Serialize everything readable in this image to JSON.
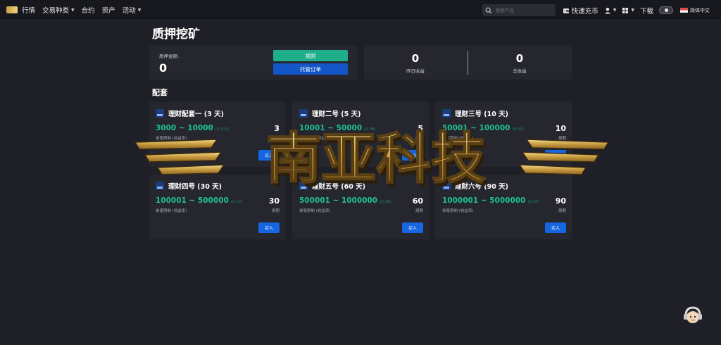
{
  "nav": {
    "items": [
      {
        "label": "行情",
        "caret": false
      },
      {
        "label": "交易种类",
        "caret": true
      },
      {
        "label": "合约",
        "caret": false
      },
      {
        "label": "资产",
        "caret": false
      },
      {
        "label": "活动",
        "caret": true
      }
    ],
    "search_placeholder": "搜索产品",
    "quick_recharge": "快速充币",
    "download": "下载",
    "language": "简体中文"
  },
  "page": {
    "title": "质押挖矿",
    "pledge_label": "质押金额:",
    "pledge_value": "0",
    "rule_button": "规则",
    "orders_button": "托管订单",
    "yesterday_value": "0",
    "yesterday_label": "昨日收益",
    "total_value": "0",
    "total_label": "总收益",
    "section_title": "配套"
  },
  "packages": [
    {
      "name": "理财配套一 (3 天)",
      "range": "3000 ~ 10000",
      "rate": "(0.024)",
      "sub": "单笔限制 (收益率)",
      "days": "3",
      "cycle": "周期",
      "buy": "买入"
    },
    {
      "name": "理财二号 (5 天)",
      "range": "10001 ~ 50000",
      "rate": "(0.08)",
      "sub": "单笔限制 (收益率)",
      "days": "5",
      "cycle": "周期",
      "buy": "买入"
    },
    {
      "name": "理财三号 (10 天)",
      "range": "50001 ~ 100000",
      "rate": "(0.09)",
      "sub": "单笔限制 (收益率)",
      "days": "10",
      "cycle": "周期",
      "buy": "买入"
    },
    {
      "name": "理财四号 (30 天)",
      "range": "100001 ~ 500000",
      "rate": "(0.12)",
      "sub": "单笔限制 (收益率)",
      "days": "30",
      "cycle": "周期",
      "buy": "买入"
    },
    {
      "name": "理财五号 (60 天)",
      "range": "500001 ~ 1000000",
      "rate": "(0.28)",
      "sub": "单笔限制 (收益率)",
      "days": "60",
      "cycle": "周期",
      "buy": "买入"
    },
    {
      "name": "理财六号 (90 天)",
      "range": "1000001 ~ 5000000",
      "rate": "(0.36)",
      "sub": "单笔限制 (收益率)",
      "days": "90",
      "cycle": "周期",
      "buy": "买入"
    }
  ],
  "watermark": {
    "text": "南亚科技"
  },
  "colors": {
    "background": "#1e1f27",
    "card": "#25262e",
    "accent_green": "#1fbf95",
    "button_blue": "#1566e0",
    "watermark_gold": "#d8b45a"
  }
}
